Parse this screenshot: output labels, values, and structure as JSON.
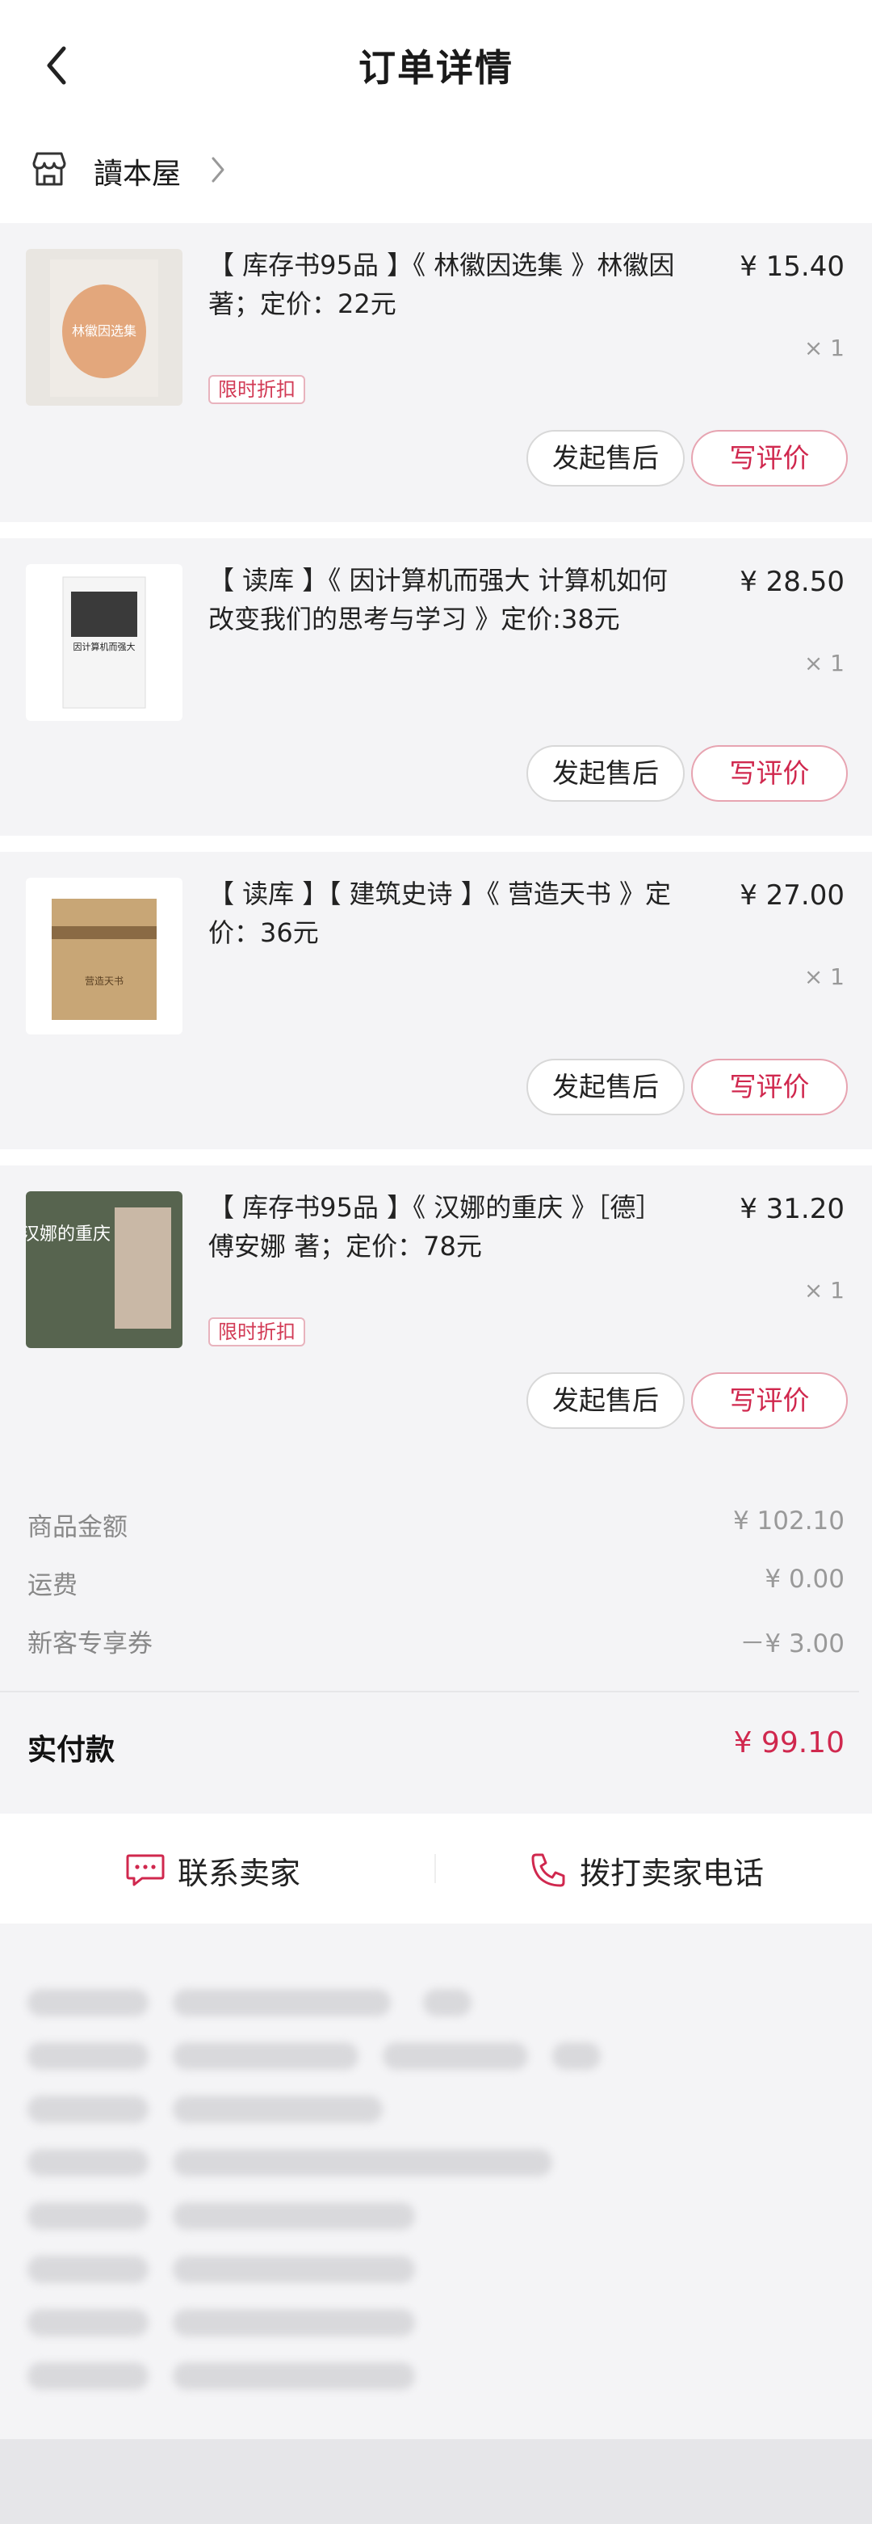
{
  "header": {
    "title": "订单详情"
  },
  "store": {
    "name": "讀本屋"
  },
  "items": [
    {
      "title": "【 库存书95品 】《 林徽因选集 》林徽因  著；定价：22元",
      "price": "¥ 15.40",
      "qty": "× 1",
      "promo": "限时折扣",
      "after_sale": "发起售后",
      "review": "写评价",
      "cover_text": "林徽因选集",
      "cover_color": "#e6a87a"
    },
    {
      "title": "【 读库 】《 因计算机而强大 计算机如何改变我们的思考与学习 》定价:38元",
      "price": "¥ 28.50",
      "qty": "× 1",
      "promo": null,
      "after_sale": "发起售后",
      "review": "写评价",
      "cover_text": "因计算机而强大",
      "cover_color": "#f0f0f0"
    },
    {
      "title": "【 读库 】【 建筑史诗 】《 营造天书 》定价：36元",
      "price": "¥ 27.00",
      "qty": "× 1",
      "promo": null,
      "after_sale": "发起售后",
      "review": "写评价",
      "cover_text": "营造天书",
      "cover_color": "#c7a574"
    },
    {
      "title": "【 库存书95品 】《 汉娜的重庆 》［德］傅安娜  著；定价：78元",
      "price": "¥ 31.20",
      "qty": "× 1",
      "promo": "限时折扣",
      "after_sale": "发起售后",
      "review": "写评价",
      "cover_text": "汉娜的重庆",
      "cover_color": "#6b7a63"
    }
  ],
  "summary": {
    "goods_label": "商品金额",
    "goods_value": "¥ 102.10",
    "shipping_label": "运费",
    "shipping_value": "¥ 0.00",
    "coupon_label": "新客专享券",
    "coupon_value": "－¥ 3.00",
    "paid_label": "实付款",
    "paid_value": "¥ 99.10"
  },
  "contact": {
    "seller": "联系卖家",
    "phone": "拨打卖家电话"
  },
  "colors": {
    "accent": "#d0284e",
    "page_bg": "#f4f4f6"
  }
}
